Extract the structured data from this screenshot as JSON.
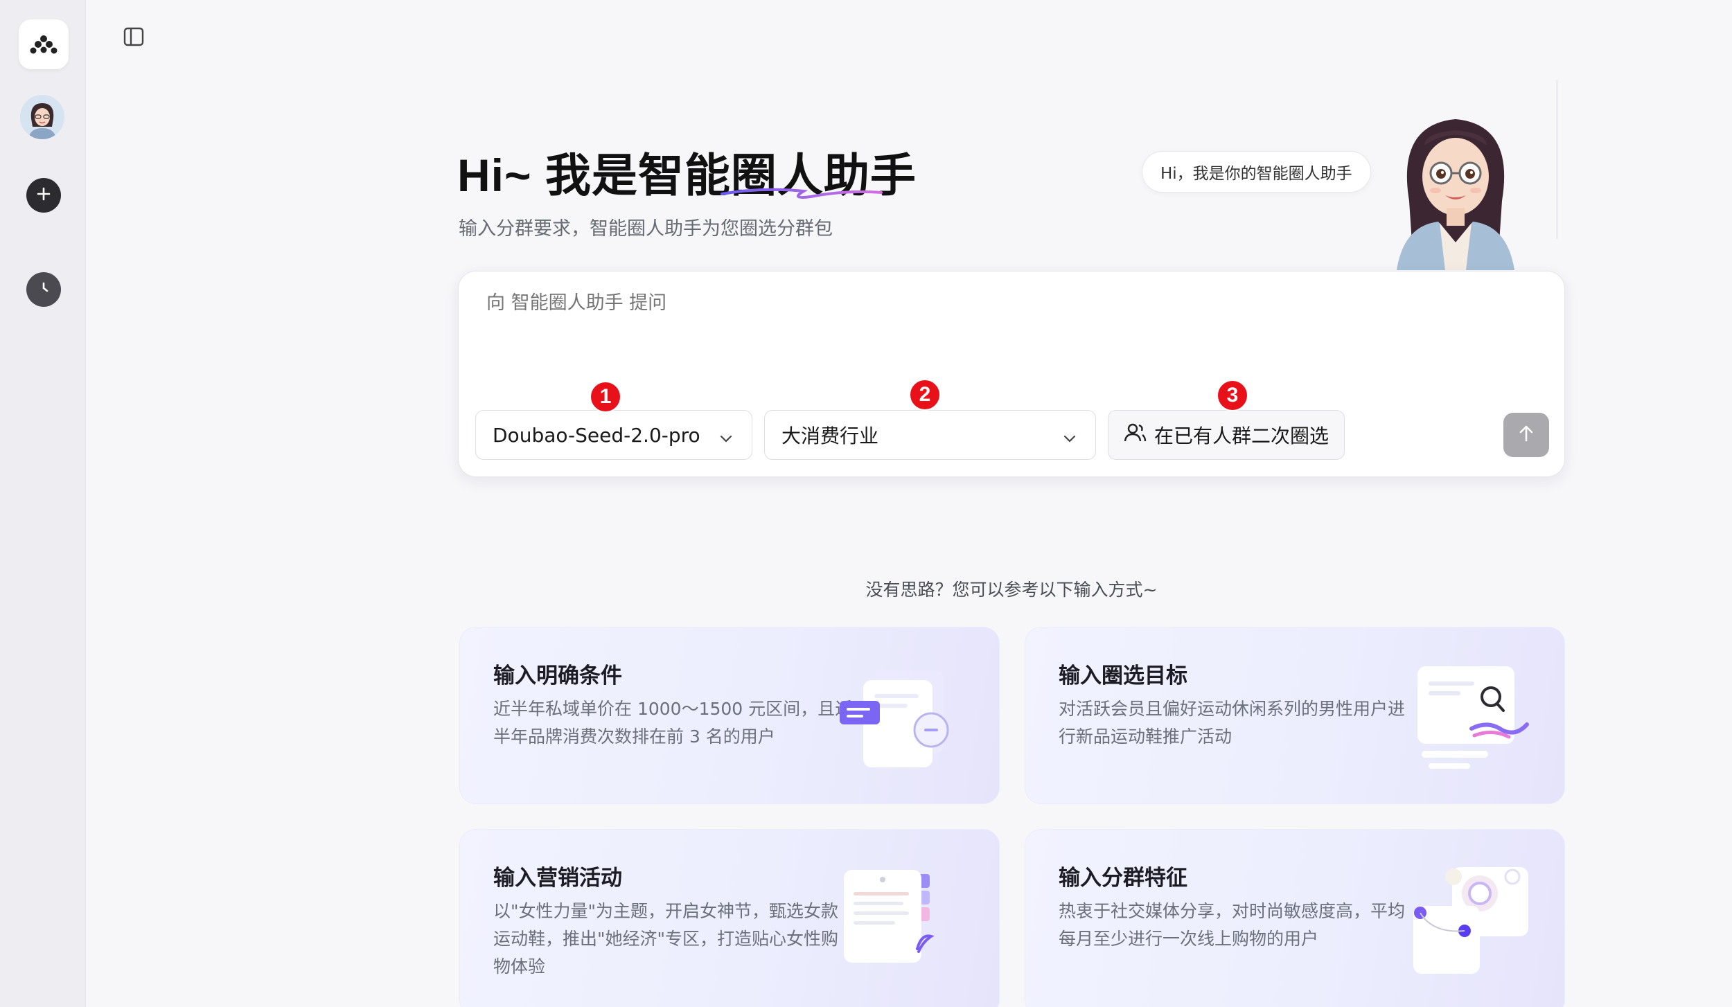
{
  "rail": {
    "logo": "app-logo-icon",
    "avatar": "user-avatar",
    "new_icon": "plus-icon",
    "history_icon": "clock-icon"
  },
  "header": {
    "sidebar_toggle_icon": "sidebar-toggle-icon"
  },
  "hero": {
    "title": "Hi~ 我是智能圈人助手",
    "subtitle": "输入分群要求，智能圈人助手为您圈选分群包",
    "bubble": "Hi，我是你的智能圈人助手"
  },
  "input": {
    "placeholder": "向 智能圈人助手 提问",
    "model": "Doubao-Seed-2.0-pro",
    "industry": "大消费行业",
    "filter_label": "在已有人群二次圈选",
    "badges": [
      "1",
      "2",
      "3"
    ]
  },
  "examples": {
    "hint": "没有思路？您可以参考以下输入方式~",
    "cards": [
      {
        "title": "输入明确条件",
        "desc": "近半年私域单价在 1000～1500 元区间，且近半年品牌消费次数排在前 3 名的用户"
      },
      {
        "title": "输入圈选目标",
        "desc": "对活跃会员且偏好运动休闲系列的男性用户进行新品运动鞋推广活动"
      },
      {
        "title": "输入营销活动",
        "desc": "以\"女性力量\"为主题，开启女神节，甄选女款运动鞋，推出\"她经济\"专区，打造贴心女性购物体验"
      },
      {
        "title": "输入分群特征",
        "desc": "热衷于社交媒体分享，对时尚敏感度高，平均每月至少进行一次线上购物的用户"
      }
    ]
  },
  "colors": {
    "accent": "#7c6cf0",
    "badge": "#e8111a",
    "send_disabled": "#a9a9ae"
  }
}
